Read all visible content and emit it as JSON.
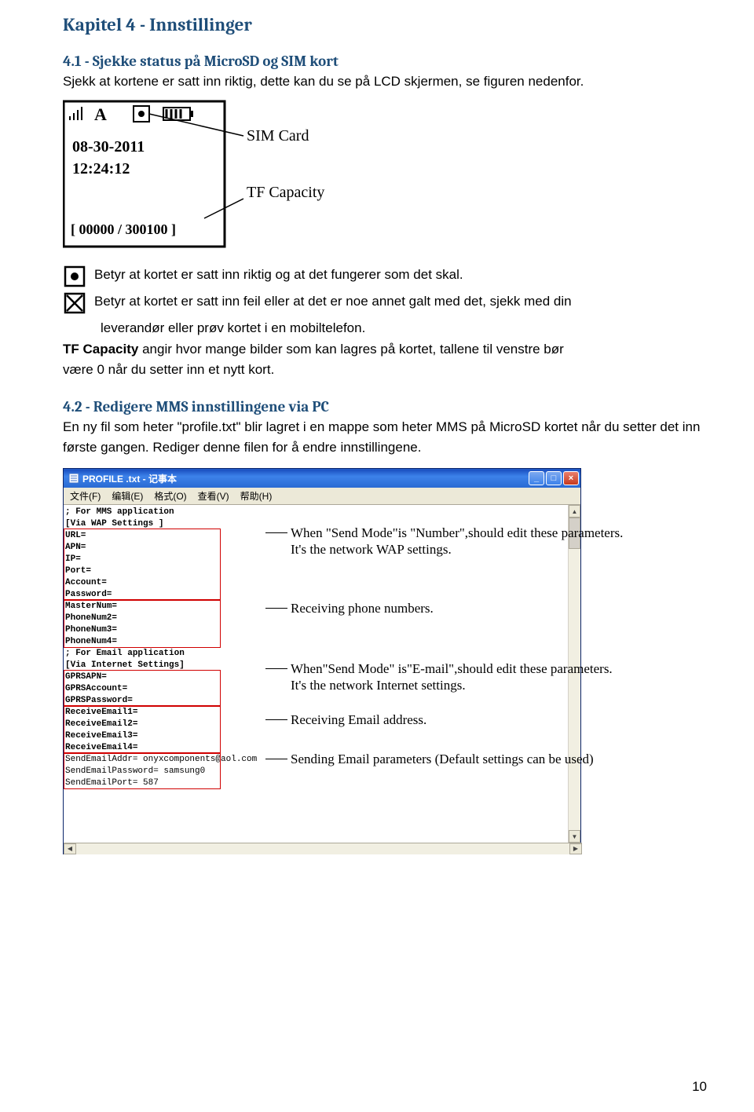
{
  "chapter_title": "Kapitel 4 - Innstillinger",
  "section1": {
    "title": "4.1 - Sjekke status på MicroSD og SIM kort",
    "intro": "Sjekk at kortene er satt inn riktig, dette kan du se på LCD skjermen, se figuren nedenfor."
  },
  "lcd": {
    "sig_A": "A",
    "date": "08-30-2011",
    "time": "12:24:12",
    "counter": "[ 00000 / 300100 ]",
    "label_sim": "SIM Card",
    "label_tf": "TF Capacity"
  },
  "icon_ok_text": "Betyr at kortet er satt inn riktig og at det fungerer som det skal.",
  "icon_fail_text": "Betyr at kortet er satt inn feil eller at det er noe annet galt med det, sjekk med din",
  "icon_fail_cont": "leverandør eller prøv kortet i en mobiltelefon.",
  "tfcap_bold": "TF Capacity",
  "tfcap_rest_line1": " angir hvor mange bilder som kan lagres på kortet, tallene til venstre bør",
  "tfcap_rest_line2": "være 0 når du setter inn et nytt kort.",
  "section2": {
    "title": "4.2 - Redigere MMS innstillingene via PC",
    "p1": "En ny fil som heter \"profile.txt\" blir lagret i en mappe som heter MMS på MicroSD kortet når du setter det inn første gangen. Rediger denne filen for å endre innstillingene."
  },
  "notepad": {
    "title": "PROFILE .txt - 记事本",
    "menus": [
      "文件(F)",
      "编辑(E)",
      "格式(O)",
      "查看(V)",
      "帮助(H)"
    ],
    "lines": [
      "; For MMS application",
      "[Via WAP Settings ]",
      "URL=",
      "APN=",
      "IP=",
      "Port=",
      "Account=",
      "Password=",
      "MasterNum=",
      "PhoneNum2=",
      "PhoneNum3=",
      "PhoneNum4=",
      "; For Email application",
      "[Via Internet Settings]",
      "GPRSAPN=",
      "GPRSAccount=",
      "GPRSPassword=",
      "ReceiveEmail1=",
      "ReceiveEmail2=",
      "ReceiveEmail3=",
      "ReceiveEmail4=",
      "SendEmailAddr= onyxcomponents@aol.com",
      "SendEmailPassword= samsung0",
      "SendEmailPort= 587"
    ]
  },
  "annotations": {
    "a1_l1": "When \"Send Mode\"is \"Number\",should edit these parameters.",
    "a1_l2": "It's the network WAP settings.",
    "a2": "Receiving phone numbers.",
    "a3_l1": "When\"Send Mode\" is\"E-mail\",should edit these parameters.",
    "a3_l2": "It's the network Internet settings.",
    "a4": "Receiving Email address.",
    "a5": "Sending Email parameters  (Default settings can be used)"
  },
  "page_number": "10"
}
